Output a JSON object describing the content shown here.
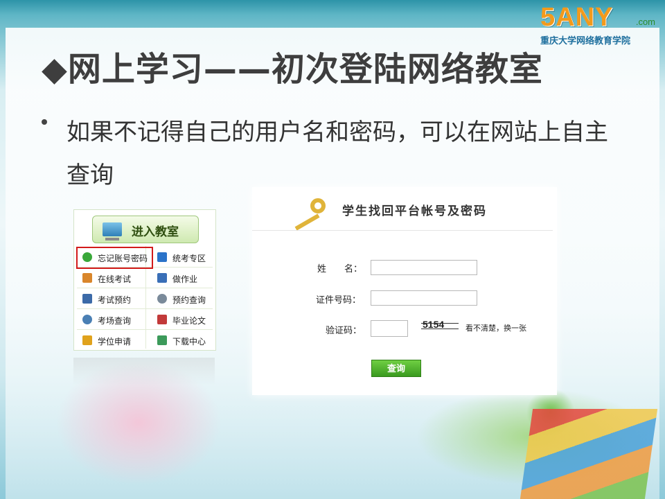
{
  "logo": {
    "brand": "5ANY",
    "domain": ".com",
    "subtitle": "重庆大学网络教育学院"
  },
  "slide": {
    "title": "◆网上学习——初次登陆网络教室",
    "bullet": "如果不记得自己的用户名和密码，可以在网站上自主查询"
  },
  "portal": {
    "header": "进入教室",
    "items": [
      {
        "label": "忘记账号密码",
        "icon": "question-circle-icon",
        "color": "#3aa83a"
      },
      {
        "label": "统考专区",
        "icon": "exam-badge-icon",
        "color": "#2b73c9"
      },
      {
        "label": "在线考试",
        "icon": "pencil-note-icon",
        "color": "#d9862b"
      },
      {
        "label": "做作业",
        "icon": "homework-icon",
        "color": "#3a6fb7"
      },
      {
        "label": "考试预约",
        "icon": "id-card-icon",
        "color": "#3c6aa8"
      },
      {
        "label": "预约查询",
        "icon": "magnifier-icon",
        "color": "#7a8a9a"
      },
      {
        "label": "考场查询",
        "icon": "people-search-icon",
        "color": "#4a7fb4"
      },
      {
        "label": "毕业论文",
        "icon": "document-icon",
        "color": "#c23a3a"
      },
      {
        "label": "学位申请",
        "icon": "medal-icon",
        "color": "#e0a21c"
      },
      {
        "label": "下载中心",
        "icon": "download-icon",
        "color": "#3c9a5a"
      }
    ]
  },
  "recovery_form": {
    "title": "学生找回平台帐号及密码",
    "name_label": "姓　　名：",
    "id_label": "证件号码：",
    "captcha_label": "验证码：",
    "captcha_text": "5154",
    "refresh_text": "看不清楚，换一张",
    "submit_label": "查询"
  }
}
